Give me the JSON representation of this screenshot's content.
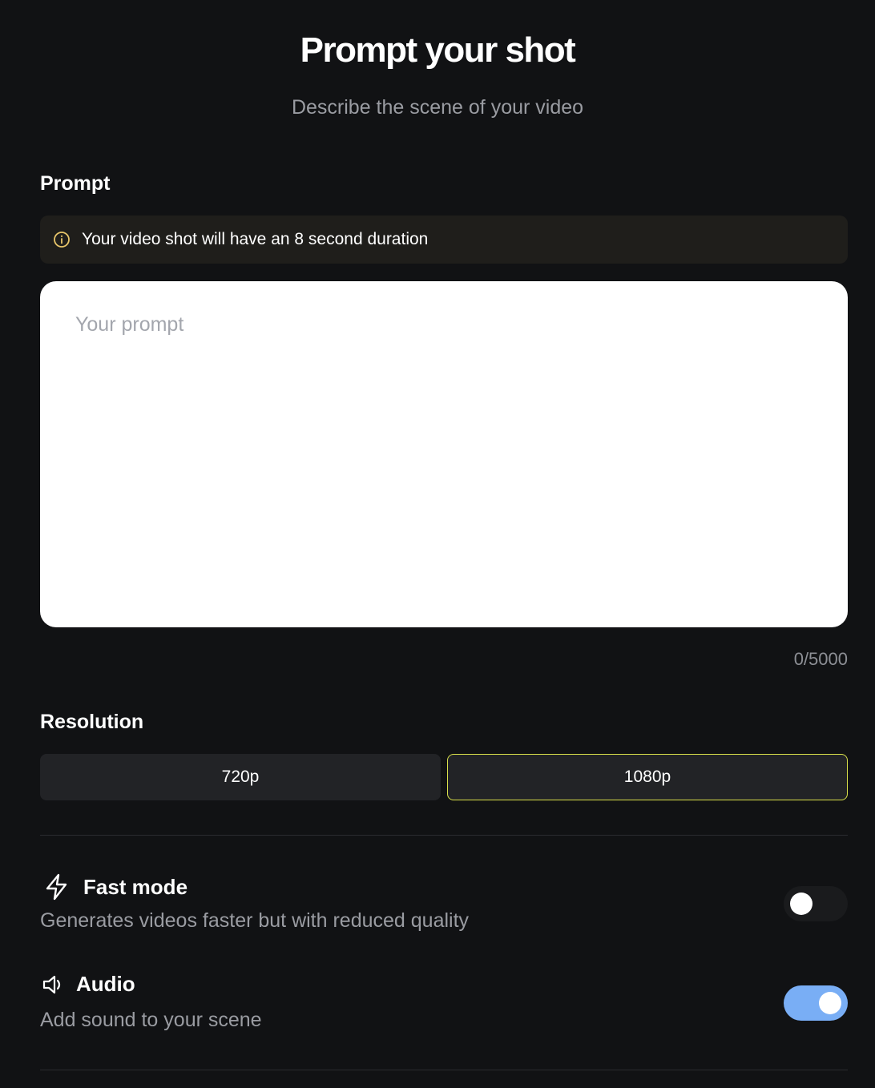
{
  "header": {
    "title": "Prompt your shot",
    "subtitle": "Describe the scene of your video"
  },
  "prompt_section": {
    "label": "Prompt",
    "info_icon": "info-circle-icon",
    "info_text": "Your video shot will have an 8 second duration",
    "input_value": "",
    "input_placeholder": "Your prompt",
    "char_count": "0/5000"
  },
  "resolution_section": {
    "label": "Resolution",
    "options": [
      {
        "label": "720p",
        "selected": false
      },
      {
        "label": "1080p",
        "selected": true
      }
    ]
  },
  "options": {
    "fast_mode": {
      "icon": "lightning-bolt-icon",
      "title": "Fast mode",
      "description": "Generates videos faster but with reduced quality",
      "enabled": false
    },
    "audio": {
      "icon": "speaker-icon",
      "title": "Audio",
      "description": "Add sound to your scene",
      "enabled": true
    }
  },
  "colors": {
    "background": "#111214",
    "accent_selected_border": "#d9e04a",
    "toggle_on": "#79aef5",
    "info_icon": "#e8c66a"
  }
}
